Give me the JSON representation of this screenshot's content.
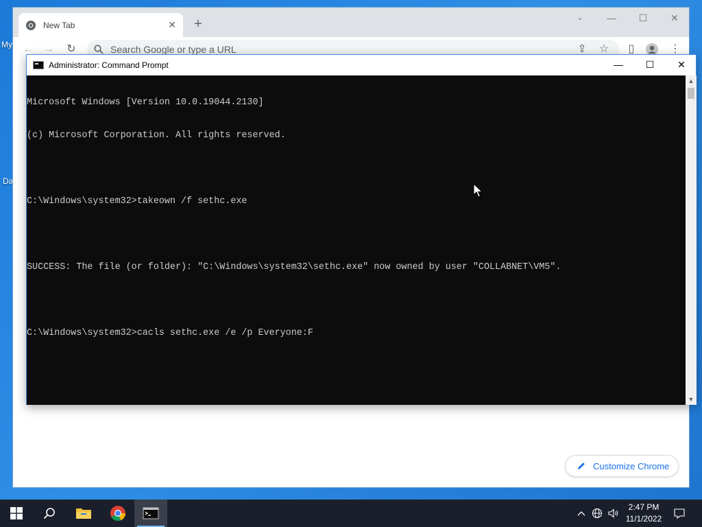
{
  "desktop": {
    "label_1": "My",
    "label_2": "Da"
  },
  "chrome": {
    "tab_title": "New Tab",
    "omnibox_placeholder": "Search Google or type a URL",
    "customize_label": "Customize Chrome",
    "accent_color": "#1a73e8"
  },
  "cmd": {
    "title": "Administrator: Command Prompt",
    "lines": [
      "Microsoft Windows [Version 10.0.19044.2130]",
      "(c) Microsoft Corporation. All rights reserved.",
      "",
      "C:\\Windows\\system32>takeown /f sethc.exe",
      "",
      "SUCCESS: The file (or folder): \"C:\\Windows\\system32\\sethc.exe\" now owned by user \"COLLABNET\\VM5\".",
      "",
      "C:\\Windows\\system32>cacls sethc.exe /e /p Everyone:F"
    ]
  },
  "taskbar": {
    "time": "2:47 PM",
    "date": "11/1/2022",
    "apps": [
      "start-icon",
      "search-icon",
      "file-explorer-icon",
      "chrome-icon",
      "command-prompt-icon"
    ]
  }
}
